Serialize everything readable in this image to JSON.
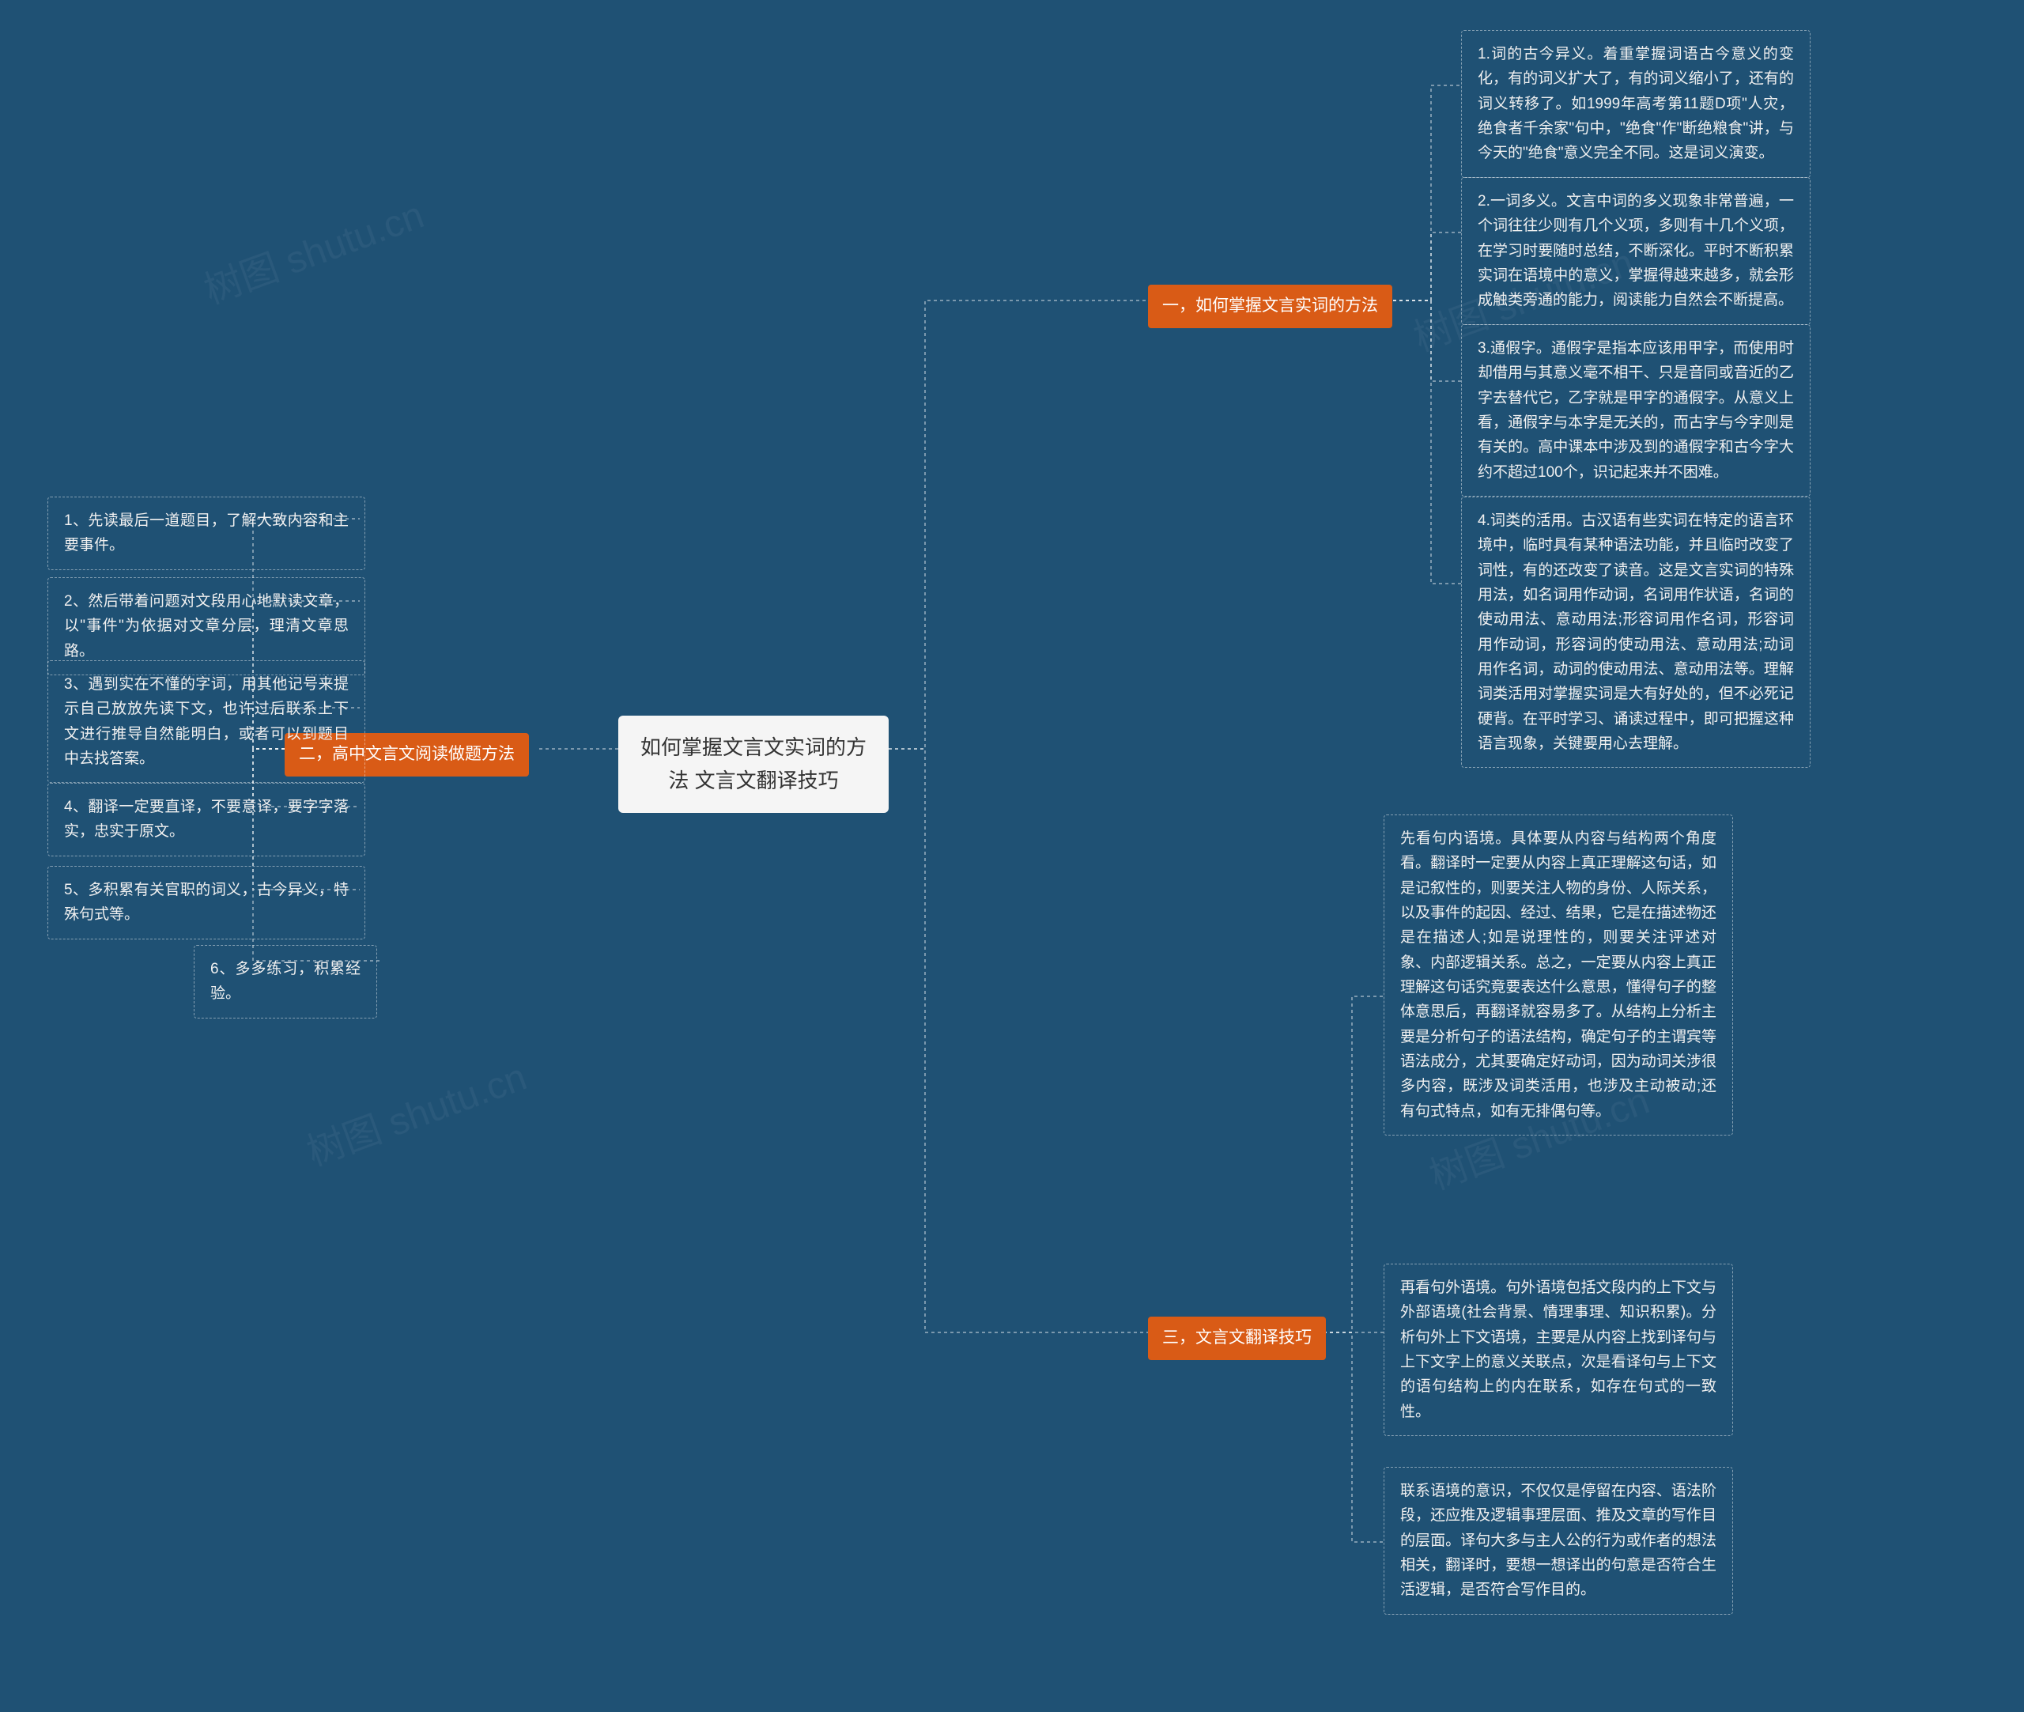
{
  "watermarks": [
    "树图 shutu.cn",
    "树图 shutu.cn",
    "树图 shutu.cn",
    "树图 shutu.cn"
  ],
  "center": {
    "title_line1": "如何掌握文言文实词的方",
    "title_line2": "法 文言文翻译技巧"
  },
  "branch1": {
    "label": "一，如何掌握文言实词的方法",
    "leaves": [
      "1.词的古今异义。着重掌握词语古今意义的变化，有的词义扩大了，有的词义缩小了，还有的词义转移了。如1999年高考第11题D项\"人灾，绝食者千余家\"句中，\"绝食\"作\"断绝粮食\"讲，与今天的\"绝食\"意义完全不同。这是词义演变。",
      "2.一词多义。文言中词的多义现象非常普遍，一个词往往少则有几个义项，多则有十几个义项，在学习时要随时总结，不断深化。平时不断积累实词在语境中的意义，掌握得越来越多，就会形成触类旁通的能力，阅读能力自然会不断提高。",
      "3.通假字。通假字是指本应该用甲字，而使用时却借用与其意义毫不相干、只是音同或音近的乙字去替代它，乙字就是甲字的通假字。从意义上看，通假字与本字是无关的，而古字与今字则是有关的。高中课本中涉及到的通假字和古今字大约不超过100个，识记起来并不困难。",
      "4.词类的活用。古汉语有些实词在特定的语言环境中，临时具有某种语法功能，并且临时改变了词性，有的还改变了读音。这是文言实词的特殊用法，如名词用作动词，名词用作状语，名词的使动用法、意动用法;形容词用作名词，形容词用作动词，形容词的使动用法、意动用法;动词用作名词，动词的使动用法、意动用法等。理解词类活用对掌握实词是大有好处的，但不必死记硬背。在平时学习、诵读过程中，即可把握这种语言现象，关键要用心去理解。"
    ]
  },
  "branch2": {
    "label": "二，高中文言文阅读做题方法",
    "leaves": [
      "1、先读最后一道题目，了解大致内容和主要事件。",
      "2、然后带着问题对文段用心地默读文章，以\"事件\"为依据对文章分层，理清文章思路。",
      "3、遇到实在不懂的字词，用其他记号来提示自己放放先读下文，也许过后联系上下文进行推导自然能明白，或者可以到题目中去找答案。",
      "4、翻译一定要直译，不要意译，要字字落实，忠实于原文。",
      "5、多积累有关官职的词义，古今异义，特殊句式等。",
      "6、多多练习，积累经验。"
    ]
  },
  "branch3": {
    "label": "三，文言文翻译技巧",
    "leaves": [
      "先看句内语境。具体要从内容与结构两个角度看。翻译时一定要从内容上真正理解这句话，如是记叙性的，则要关注人物的身份、人际关系，以及事件的起因、经过、结果，它是在描述物还是在描述人;如是说理性的，则要关注评述对象、内部逻辑关系。总之，一定要从内容上真正理解这句话究竟要表达什么意思，懂得句子的整体意思后，再翻译就容易多了。从结构上分析主要是分析句子的语法结构，确定句子的主谓宾等语法成分，尤其要确定好动词，因为动词关涉很多内容，既涉及词类活用，也涉及主动被动;还有句式特点，如有无排偶句等。",
      "再看句外语境。句外语境包括文段内的上下文与外部语境(社会背景、情理事理、知识积累)。分析句外上下文语境，主要是从内容上找到译句与上下文字上的意义关联点，次是看译句与上下文的语句结构上的内在联系，如存在句式的一致性。",
      "联系语境的意识，不仅仅是停留在内容、语法阶段，还应推及逻辑事理层面、推及文章的写作目的层面。译句大多与主人公的行为或作者的想法相关，翻译时，要想一想译出的句意是否符合生活逻辑，是否符合写作目的。"
    ]
  }
}
